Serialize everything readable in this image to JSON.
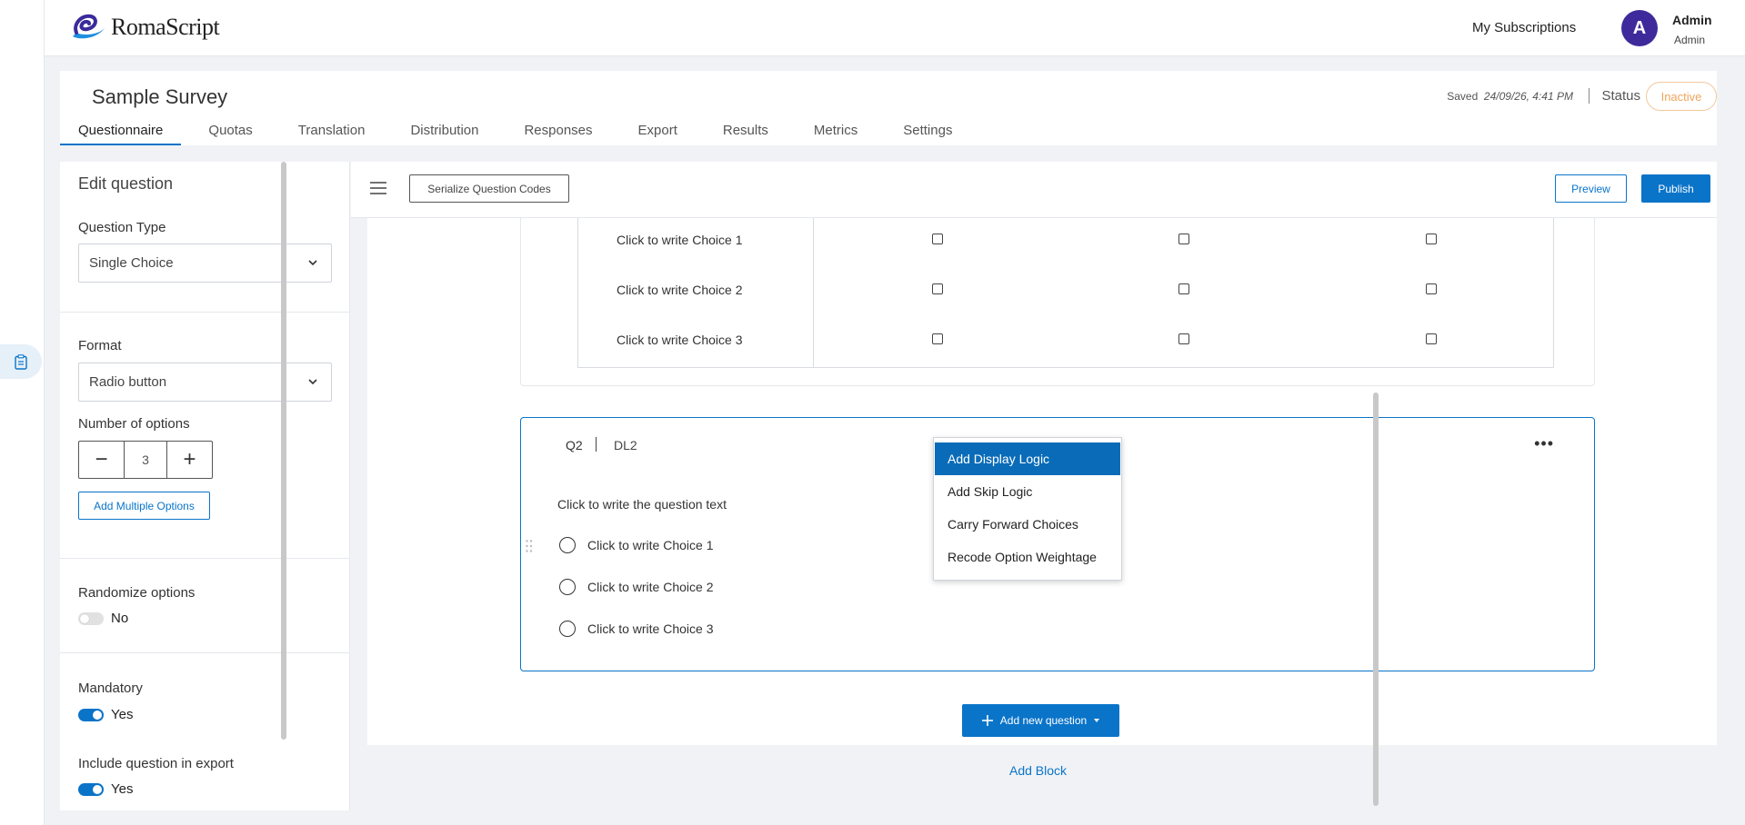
{
  "app": {
    "logo_text": "RomaScript"
  },
  "header": {
    "my_subscriptions": "My Subscriptions",
    "avatar_letter": "A",
    "user_name": "Admin",
    "user_role": "Admin"
  },
  "survey": {
    "title": "Sample Survey",
    "saved_label": "Saved",
    "saved_time": "24/09/26, 4:41 PM",
    "status_label": "Status",
    "status_value": "Inactive"
  },
  "tabs": [
    {
      "label": "Questionnaire",
      "active": true
    },
    {
      "label": "Quotas"
    },
    {
      "label": "Translation"
    },
    {
      "label": "Distribution"
    },
    {
      "label": "Responses"
    },
    {
      "label": "Export"
    },
    {
      "label": "Results"
    },
    {
      "label": "Metrics"
    },
    {
      "label": "Settings"
    }
  ],
  "edit_panel": {
    "title": "Edit question",
    "question_type_label": "Question Type",
    "question_type_value": "Single Choice",
    "format_label": "Format",
    "format_value": "Radio button",
    "num_options_label": "Number of options",
    "num_options_value": "3",
    "minus_glyph": "−",
    "plus_glyph": "+",
    "add_multiple_options": "Add Multiple Options",
    "randomize_label": "Randomize options",
    "randomize_value": "No",
    "mandatory_label": "Mandatory",
    "mandatory_value": "Yes",
    "include_export_label": "Include question in export",
    "include_export_value": "Yes"
  },
  "toolbar": {
    "serialize": "Serialize Question Codes",
    "preview": "Preview",
    "publish": "Publish"
  },
  "q1_matrix": {
    "rows": [
      "Click to write Choice 1",
      "Click to write Choice 2",
      "Click to write Choice 3"
    ]
  },
  "q2": {
    "id": "Q2",
    "code": "DL2",
    "menu_glyph": "•••",
    "text": "Click to write the question text",
    "choices": [
      "Click to write Choice 1",
      "Click to write Choice 2",
      "Click to write Choice 3"
    ]
  },
  "context_menu": {
    "items": [
      "Add Display Logic",
      "Add Skip Logic",
      "Carry Forward Choices",
      "Recode Option Weightage"
    ]
  },
  "footer": {
    "add_new_question": "Add new question",
    "add_block": "Add Block"
  },
  "colors": {
    "accent": "#0a74c9",
    "menu_highlight": "#0a6cb8",
    "status_inactive": "#f0a55c",
    "avatar_bg": "#3f2a9c"
  }
}
